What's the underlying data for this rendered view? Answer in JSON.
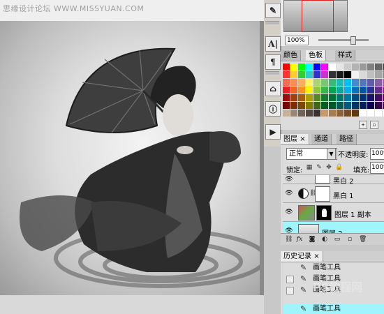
{
  "watermark_top": "思缘设计论坛 WWW.MISSYUAN.COM",
  "navigator": {
    "zoom": "100%"
  },
  "swatches": {
    "tabs": [
      "颜色",
      "色板",
      "样式"
    ],
    "active_tab": 1,
    "colors": [
      "#ff0000",
      "#ffff00",
      "#00ff00",
      "#00ffff",
      "#0000ff",
      "#ff00ff",
      "#ffffff",
      "#e6e6e6",
      "#cccccc",
      "#b3b3b3",
      "#999999",
      "#808080",
      "#666666",
      "#4d4d4d",
      "#ff3333",
      "#ffcc33",
      "#33cc33",
      "#33cccc",
      "#3333cc",
      "#cc33cc",
      "#333333",
      "#1a1a1a",
      "#000000",
      "#f2f2f2",
      "#d9d9d9",
      "#bfbfbf",
      "#a6a6a6",
      "#8c8c8c",
      "#f26c4f",
      "#f68e55",
      "#fbaf5c",
      "#fff467",
      "#acd372",
      "#7cc576",
      "#3bb878",
      "#1abbb4",
      "#00bff3",
      "#438ccb",
      "#5574b9",
      "#605ca8",
      "#855fa8",
      "#a763a8",
      "#ed1c24",
      "#f26522",
      "#f7941d",
      "#fff200",
      "#8dc63f",
      "#39b54a",
      "#00a651",
      "#00a99d",
      "#00aeef",
      "#0072bc",
      "#0054a6",
      "#2e3192",
      "#662d91",
      "#92278f",
      "#9e0b0f",
      "#a0410d",
      "#a36209",
      "#aba000",
      "#598527",
      "#197b30",
      "#007236",
      "#00746b",
      "#0076a3",
      "#004a80",
      "#003471",
      "#1b1464",
      "#440e62",
      "#630460",
      "#790000",
      "#7b2e00",
      "#7d4900",
      "#827b00",
      "#406618",
      "#005e20",
      "#005826",
      "#005952",
      "#005b7f",
      "#003663",
      "#002157",
      "#0d004c",
      "#32004b",
      "#4b0049",
      "#c7b299",
      "#998675",
      "#736357",
      "#534741",
      "#37302d",
      "#c69c6d",
      "#a67c52",
      "#8c6239",
      "#754c24",
      "#603913",
      "#ffffff",
      "#ffffff",
      "#ffffff",
      "#ffffff"
    ]
  },
  "layers": {
    "tabs": [
      "图层",
      "通道",
      "路径"
    ],
    "blend_mode": "正常",
    "opacity_label": "不透明度:",
    "opacity_value": "100%",
    "lock_label": "锁定:",
    "fill_label": "填充:",
    "fill_value": "100%",
    "items": [
      {
        "name": "黑白 2",
        "type": "adjustment",
        "selected": false
      },
      {
        "name": "黑白 1",
        "type": "adjustment",
        "selected": false
      },
      {
        "name": "图层 1 副本",
        "type": "image-masked",
        "selected": false
      },
      {
        "name": "图层 2",
        "type": "image",
        "selected": true
      }
    ]
  },
  "history": {
    "tab": "历史记录",
    "items": [
      {
        "label": "画笔工具",
        "selected": false
      },
      {
        "label": "画笔工具",
        "selected": false
      },
      {
        "label": "画笔工具",
        "selected": false
      },
      {
        "label": "画笔工具",
        "selected": true
      }
    ]
  },
  "watermark_bottom": "PS教程网"
}
